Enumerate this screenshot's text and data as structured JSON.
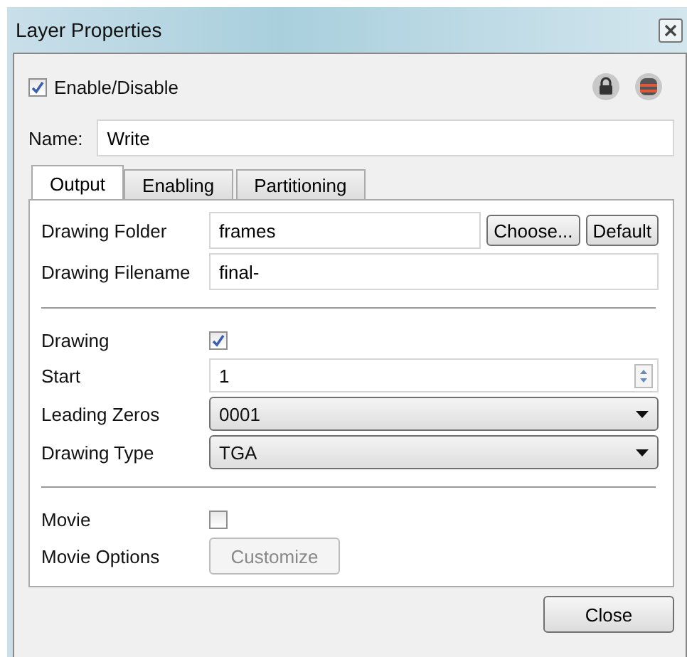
{
  "window": {
    "title": "Layer Properties"
  },
  "enable": {
    "label": "Enable/Disable",
    "checked": true
  },
  "name": {
    "label": "Name:",
    "value": "Write"
  },
  "tabs": [
    {
      "label": "Output",
      "selected": true
    },
    {
      "label": "Enabling",
      "selected": false
    },
    {
      "label": "Partitioning",
      "selected": false
    }
  ],
  "groups": [
    [
      {
        "kind": "field",
        "label": "Drawing Folder",
        "value": "frames",
        "buttons": [
          {
            "label": "Choose...",
            "disabled": false
          },
          {
            "label": "Default",
            "disabled": false
          }
        ]
      },
      {
        "kind": "field",
        "label": "Drawing Filename",
        "value": "final-"
      }
    ],
    [
      {
        "kind": "checkbox",
        "label": "Drawing",
        "checked": true
      },
      {
        "kind": "spinner",
        "label": "Start",
        "value": "1"
      },
      {
        "kind": "dropdown",
        "label": "Leading Zeros",
        "value": "0001"
      },
      {
        "kind": "dropdown",
        "label": "Drawing Type",
        "value": "TGA"
      }
    ],
    [
      {
        "kind": "checkbox",
        "label": "Movie",
        "checked": false
      },
      {
        "kind": "button",
        "label": "Movie Options",
        "button": {
          "label": "Customize",
          "disabled": true
        }
      }
    ]
  ],
  "footer_buttons": [
    {
      "label": "Close",
      "disabled": false
    }
  ]
}
